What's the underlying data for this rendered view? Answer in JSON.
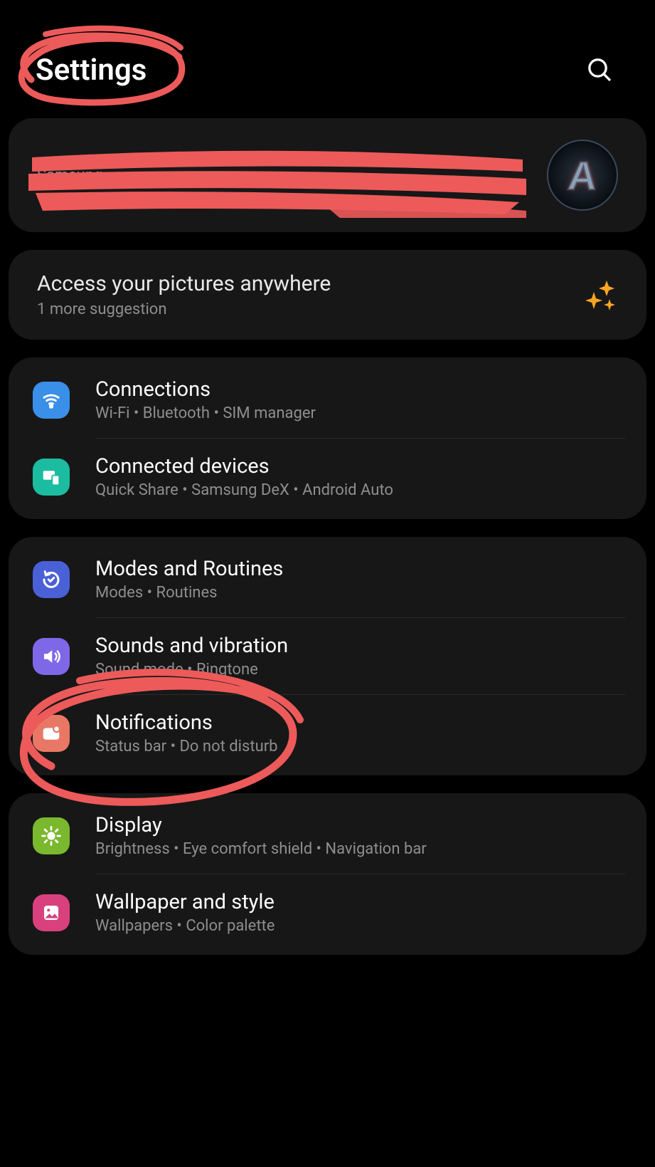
{
  "header": {
    "title": "Settings"
  },
  "profile": {
    "subtext_visible": "Samsung"
  },
  "suggestion": {
    "title": "Access your pictures anywhere",
    "sub": "1 more suggestion"
  },
  "groups": [
    {
      "items": [
        {
          "icon": "wifi",
          "title": "Connections",
          "sub": "Wi-Fi  •  Bluetooth  •  SIM manager"
        },
        {
          "icon": "conn",
          "title": "Connected devices",
          "sub": "Quick Share  •  Samsung DeX  •  Android Auto"
        }
      ]
    },
    {
      "items": [
        {
          "icon": "modes",
          "title": "Modes and Routines",
          "sub": "Modes  •  Routines"
        },
        {
          "icon": "sound",
          "title": "Sounds and vibration",
          "sub": "Sound mode  •  Ringtone"
        },
        {
          "icon": "notif",
          "title": "Notifications",
          "sub": "Status bar  •  Do not disturb"
        }
      ]
    },
    {
      "items": [
        {
          "icon": "display",
          "title": "Display",
          "sub": "Brightness  •  Eye comfort shield  •  Navigation bar"
        },
        {
          "icon": "wall",
          "title": "Wallpaper and style",
          "sub": "Wallpapers  •  Color palette"
        }
      ]
    }
  ],
  "annotations": {
    "settings_circled": true,
    "notifications_circled": true,
    "profile_redacted": true,
    "scribble_color": "#ed5a5a"
  }
}
